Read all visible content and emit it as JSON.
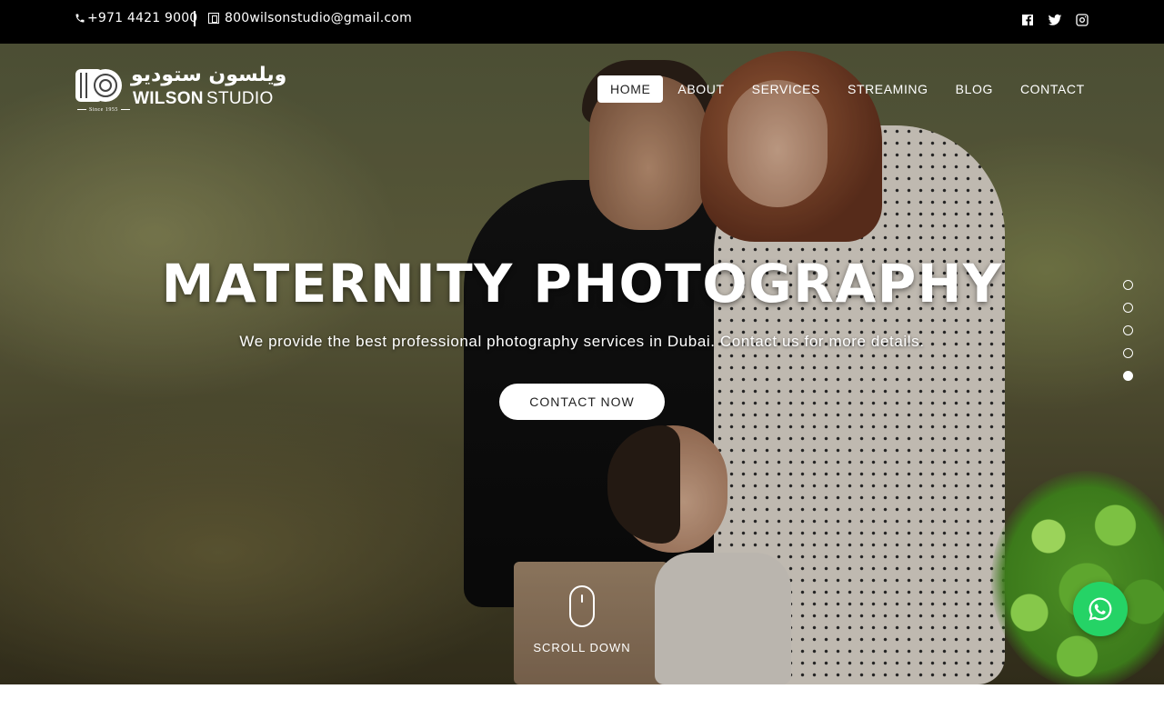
{
  "topbar": {
    "phone": "+971 4421 9000",
    "email": "800wilsonstudio@gmail.com",
    "social_icons": [
      "facebook-icon",
      "twitter-icon",
      "instagram-icon"
    ]
  },
  "logo": {
    "arabic": "ويلسون ستوديو",
    "wilson": "WILSON",
    "studio": "STUDIO",
    "since": "Since 1955"
  },
  "nav": {
    "items": [
      {
        "label": "HOME",
        "active": true
      },
      {
        "label": "ABOUT",
        "active": false
      },
      {
        "label": "SERVICES",
        "active": false
      },
      {
        "label": "STREAMING",
        "active": false
      },
      {
        "label": "BLOG",
        "active": false
      },
      {
        "label": "CONTACT",
        "active": false
      }
    ]
  },
  "hero": {
    "title": "MATERNITY PHOTOGRAPHY",
    "subtitle": "We provide the best professional photography services in Dubai. Contact us for more details.",
    "cta_label": "CONTACT NOW",
    "scroll_label": "SCROLL DOWN",
    "slides_total": 5,
    "active_slide": 5
  },
  "colors": {
    "topbar_bg": "#000000",
    "whatsapp": "#25d366",
    "text": "#ffffff"
  }
}
